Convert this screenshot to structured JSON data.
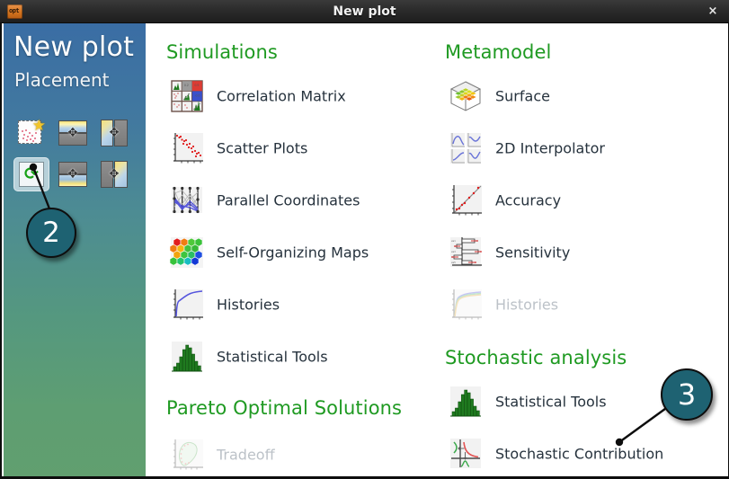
{
  "window": {
    "title": "New plot",
    "app_icon": "opt-app-icon",
    "close_label": "×"
  },
  "sidebar": {
    "title": "New plot",
    "subtitle": "Placement",
    "placement_options": [
      {
        "name": "new-plot",
        "icon": "new-plot-star-icon",
        "selected": false
      },
      {
        "name": "split-top",
        "icon": "split-horizontal-top-icon",
        "selected": false
      },
      {
        "name": "split-left",
        "icon": "split-vertical-left-icon",
        "selected": false
      },
      {
        "name": "replace",
        "icon": "refresh-replace-icon",
        "selected": true
      },
      {
        "name": "split-bottom",
        "icon": "split-horizontal-bottom-icon",
        "selected": false
      },
      {
        "name": "split-right",
        "icon": "split-vertical-right-icon",
        "selected": false
      }
    ]
  },
  "columns": {
    "left": [
      {
        "heading": "Simulations",
        "items": [
          {
            "label": "Correlation Matrix",
            "icon": "correlation-matrix-icon",
            "disabled": false
          },
          {
            "label": "Scatter Plots",
            "icon": "scatter-plot-icon",
            "disabled": false
          },
          {
            "label": "Parallel Coordinates",
            "icon": "parallel-coordinates-icon",
            "disabled": false
          },
          {
            "label": "Self-Organizing Maps",
            "icon": "self-organizing-map-icon",
            "disabled": false
          },
          {
            "label": "Histories",
            "icon": "histories-icon",
            "disabled": false
          },
          {
            "label": "Statistical Tools",
            "icon": "histogram-icon",
            "disabled": false
          }
        ]
      },
      {
        "heading": "Pareto Optimal Solutions",
        "items": [
          {
            "label": "Tradeoff",
            "icon": "tradeoff-icon",
            "disabled": true
          }
        ]
      }
    ],
    "right": [
      {
        "heading": "Metamodel",
        "items": [
          {
            "label": "Surface",
            "icon": "surface-3d-icon",
            "disabled": false
          },
          {
            "label": "2D Interpolator",
            "icon": "interpolator-2d-icon",
            "disabled": false
          },
          {
            "label": "Accuracy",
            "icon": "accuracy-icon",
            "disabled": false
          },
          {
            "label": "Sensitivity",
            "icon": "sensitivity-icon",
            "disabled": false
          },
          {
            "label": "Histories",
            "icon": "histories-icon",
            "disabled": true
          }
        ]
      },
      {
        "heading": "Stochastic analysis",
        "items": [
          {
            "label": "Statistical Tools",
            "icon": "histogram-icon",
            "disabled": false
          },
          {
            "label": "Stochastic Contribution",
            "icon": "stochastic-contribution-icon",
            "disabled": false
          }
        ]
      }
    ]
  },
  "callouts": [
    {
      "number": "2",
      "target": "replace-placement-button"
    },
    {
      "number": "3",
      "target": "stochastic-contribution-item"
    }
  ],
  "colors": {
    "heading_green": "#1f9a22",
    "label_dark": "#26323d",
    "label_disabled": "#bcc2c8",
    "sidebar_top": "#3a6da4",
    "sidebar_bottom": "#619f6f",
    "badge": "#1e6272",
    "titlebar": "#2b2b2b"
  }
}
